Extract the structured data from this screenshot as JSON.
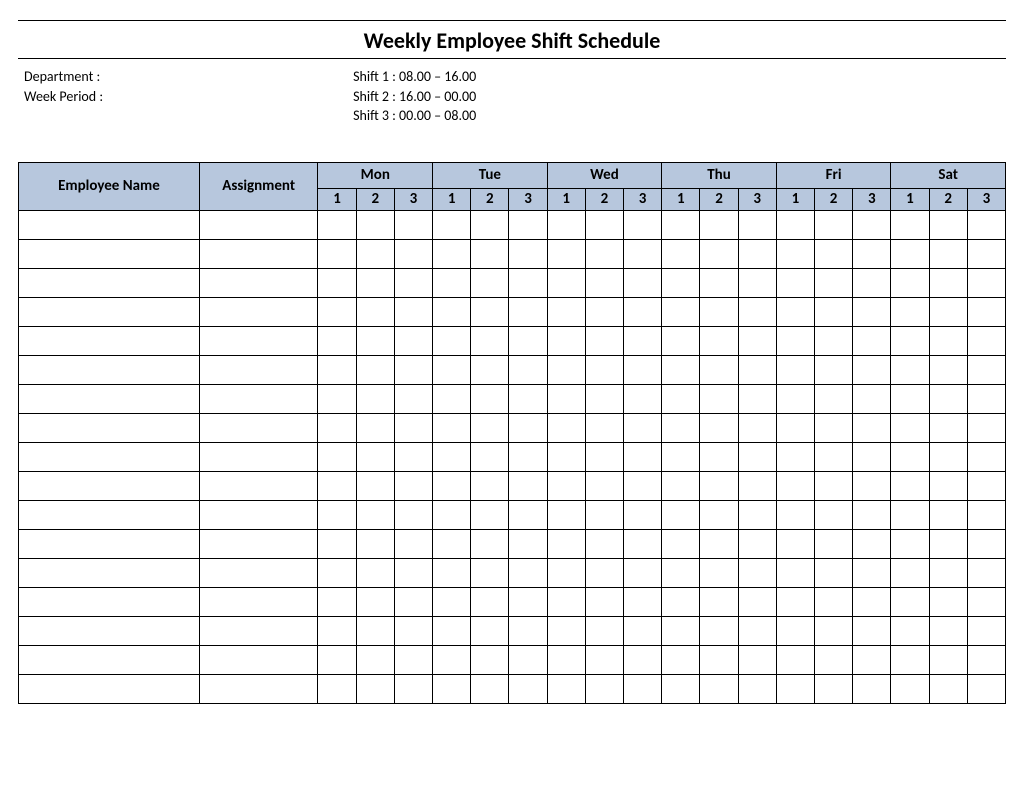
{
  "title": "Weekly Employee Shift Schedule",
  "metaLeft": {
    "department": "Department    :",
    "week": "Week  Period :"
  },
  "shifts": {
    "s1": "Shift 1  : 08.00  – 16.00",
    "s2": "Shift 2  : 16.00  – 00.00",
    "s3": "Shift 3  : 00.00  – 08.00"
  },
  "headers": {
    "employee": "Employee Name",
    "assignment": "Assignment",
    "days": [
      "Mon",
      "Tue",
      "Wed",
      "Thu",
      "Fri",
      "Sat"
    ],
    "shiftNums": [
      "1",
      "2",
      "3"
    ]
  },
  "rowCount": 17
}
